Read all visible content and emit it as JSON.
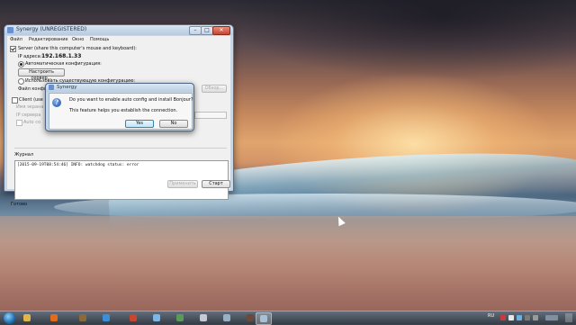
{
  "window": {
    "title": "Synergy (UNREGISTERED)",
    "min_label": "–",
    "max_label": "□",
    "close_label": "✕",
    "menu": [
      "Файл",
      "Редактирование",
      "Окно",
      "Помощь"
    ],
    "server_checkbox_label": "Server (share this computer's mouse and keyboard):",
    "ip_label": "IP адреса:",
    "ip_value": "192.168.1.33",
    "auto_config_label": "Автоматическая конфигурация:",
    "configure_server_button": "Настроить сервер...",
    "use_existing_config_label": "Использовать существующую конфигурацию:",
    "config_file_label": "Файл конфи",
    "browse_button": "Обзор...",
    "client_checkbox_label": "Client (use",
    "screen_name_label": "Имя экрана",
    "ip_server_label": "IP сервера",
    "auto_config_client_label": "Auto co",
    "log_label": "Журнал",
    "log_line": "[2015-09-19T08:54:46] INFO: watchdog status: error",
    "status_text": "Готово",
    "apply_button": "Применить",
    "start_button": "Старт"
  },
  "dialog": {
    "title": "Synergy",
    "question": "Do you want to enable auto config and install Bonjour?",
    "info": "This feature helps you establish the connection.",
    "yes_button": "Yes",
    "no_button": "No"
  },
  "taskbar": {
    "apps": [
      {
        "name": "explorer",
        "color": "#e0b64a"
      },
      {
        "name": "firefox",
        "color": "#e56a1c"
      },
      {
        "name": "media",
        "color": "#8a6a3a"
      },
      {
        "name": "ie",
        "color": "#3a8fd8"
      },
      {
        "name": "app5",
        "color": "#c9452d"
      },
      {
        "name": "app6",
        "color": "#7ab8e8"
      },
      {
        "name": "app7",
        "color": "#5c9a5a"
      },
      {
        "name": "app8",
        "color": "#c8c8d8"
      },
      {
        "name": "app9",
        "color": "#9ab0c4"
      },
      {
        "name": "app10",
        "color": "#6a4a3a"
      },
      {
        "name": "synergy",
        "color": "#a8c0d8"
      }
    ],
    "lang": "RU"
  },
  "colors": {
    "window_frame": "#c9d6e4",
    "dialog_frame": "#c5d6e8",
    "accent": "#3c7fb1"
  }
}
